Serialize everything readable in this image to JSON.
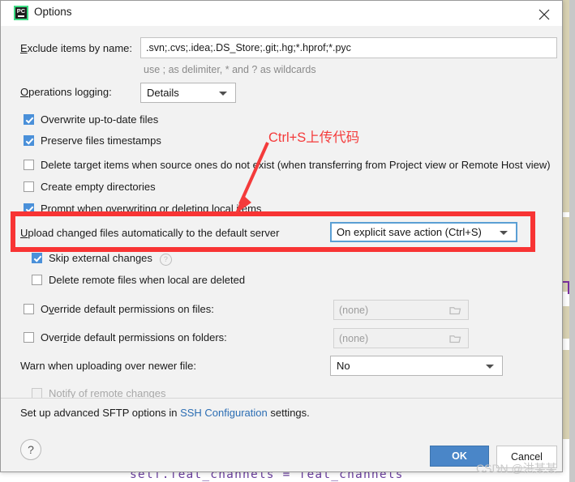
{
  "window": {
    "title": "Options",
    "app_icon": "pycharm-icon",
    "icon_label": "PC",
    "close_icon": "close-icon"
  },
  "fields": {
    "exclude_label": "Exclude items by name:",
    "exclude_value": ".svn;.cvs;.idea;.DS_Store;.git;.hg;*.hprof;*.pyc",
    "exclude_hint": "use ; as delimiter, * and ? as wildcards",
    "operations_logging_label": "Operations logging:",
    "operations_logging_value": "Details",
    "upload_auto_label": "Upload changed files automatically to the default server",
    "upload_auto_value": "On explicit save action (Ctrl+S)",
    "override_files_label": "Override default permissions on files:",
    "override_files_value": "(none)",
    "override_folders_label": "Override default permissions on folders:",
    "override_folders_value": "(none)",
    "warn_newer_label": "Warn when uploading over newer file:",
    "warn_newer_value": "No"
  },
  "checkboxes": [
    {
      "label": "Overwrite up-to-date files",
      "checked": true,
      "disabled": false
    },
    {
      "label": "Preserve files timestamps",
      "checked": true,
      "disabled": false
    },
    {
      "label": "Delete target items when source ones do not exist (when transferring from Project view or Remote Host view)",
      "checked": false,
      "disabled": false
    },
    {
      "label": "Create empty directories",
      "checked": false,
      "disabled": false
    },
    {
      "label": "Prompt when overwriting or deleting local items",
      "checked": true,
      "disabled": false
    },
    {
      "label": "Skip external changes",
      "checked": true,
      "disabled": false,
      "help": "?"
    },
    {
      "label": "Delete remote files when local are deleted",
      "checked": false,
      "disabled": false
    },
    {
      "label": "Notify of remote changes",
      "checked": false,
      "disabled": true
    }
  ],
  "sftp_note": {
    "prefix": "Set up advanced SFTP options in ",
    "link": "SSH Configuration",
    "suffix": " settings."
  },
  "buttons": {
    "help": "?",
    "ok": "OK",
    "cancel": "Cancel"
  },
  "annotations": {
    "text": "Ctrl+S上传代码",
    "arrow_color": "#f43b3b",
    "rect_color": "#f83434",
    "watermark": "CSDN @洪某某"
  },
  "background": {
    "code_line": "self.feat_channels = feat_channels"
  }
}
